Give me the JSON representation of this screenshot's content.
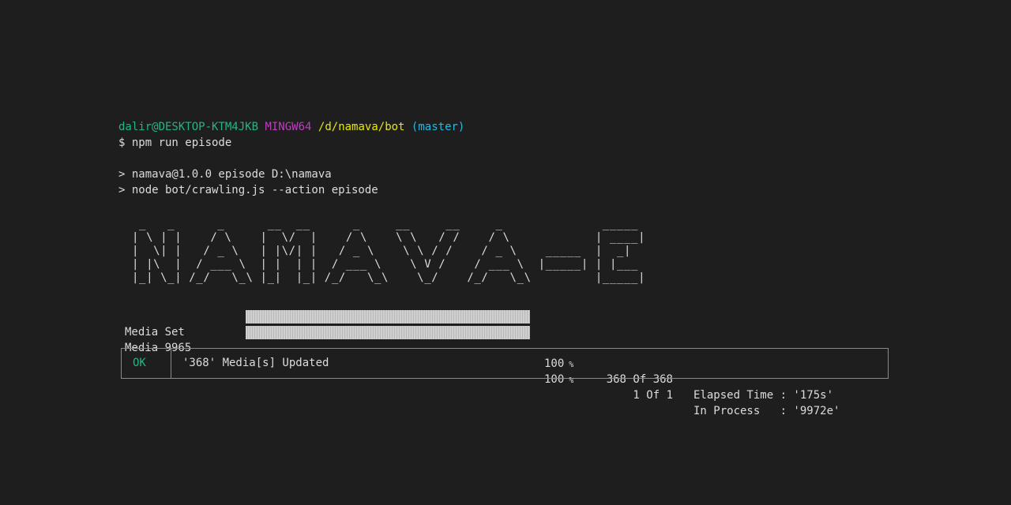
{
  "prompt": {
    "user_host": "dalir@DESKTOP-KTM4JKB",
    "system": "MINGW64",
    "path": "/d/namava/bot",
    "branch": "(master)"
  },
  "command": "$ npm run episode",
  "output": {
    "script_line": "> namava@1.0.0 episode D:\\namava",
    "node_line": "> node bot/crawling.js --action episode"
  },
  "banner": {
    "ascii": "  _   _      _      __  __      _     __     __     _              _____ \n | \\ | |    / \\    |  \\/  |    / \\    \\ \\   / /    / \\            | ____|\n |  \\| |   / _ \\   | |\\/| |   / _ \\    \\ \\ / /    / _ \\    _____  |  _|  \n | |\\  |  / ___ \\  | |  | |  / ___ \\    \\ V /    / ___ \\  |_____| | |___ \n |_| \\_| /_/   \\_\\ |_|  |_| /_/   \\_\\    \\_/    /_/   \\_\\         |_____|"
  },
  "progress": [
    {
      "label": "Media Set",
      "percent": 100,
      "percent_text": "100",
      "unit": "%",
      "count": "368 Of 368",
      "info": "Elapsed Time : '175s'"
    },
    {
      "label": "Media 9965",
      "percent": 100,
      "percent_text": "100",
      "unit": "%",
      "count": "1 Of 1",
      "info": "In Process   : '9972e'"
    }
  ],
  "status": {
    "label": "OK",
    "message": "'368' Media[s] Updated"
  },
  "colors": {
    "background": "#1e1e1e",
    "text": "#dcdcdc",
    "prompt_user": "#23b48a",
    "prompt_system": "#bc3fbc",
    "prompt_path": "#e5e510",
    "prompt_branch": "#29b8db",
    "ok": "#23b48a"
  }
}
